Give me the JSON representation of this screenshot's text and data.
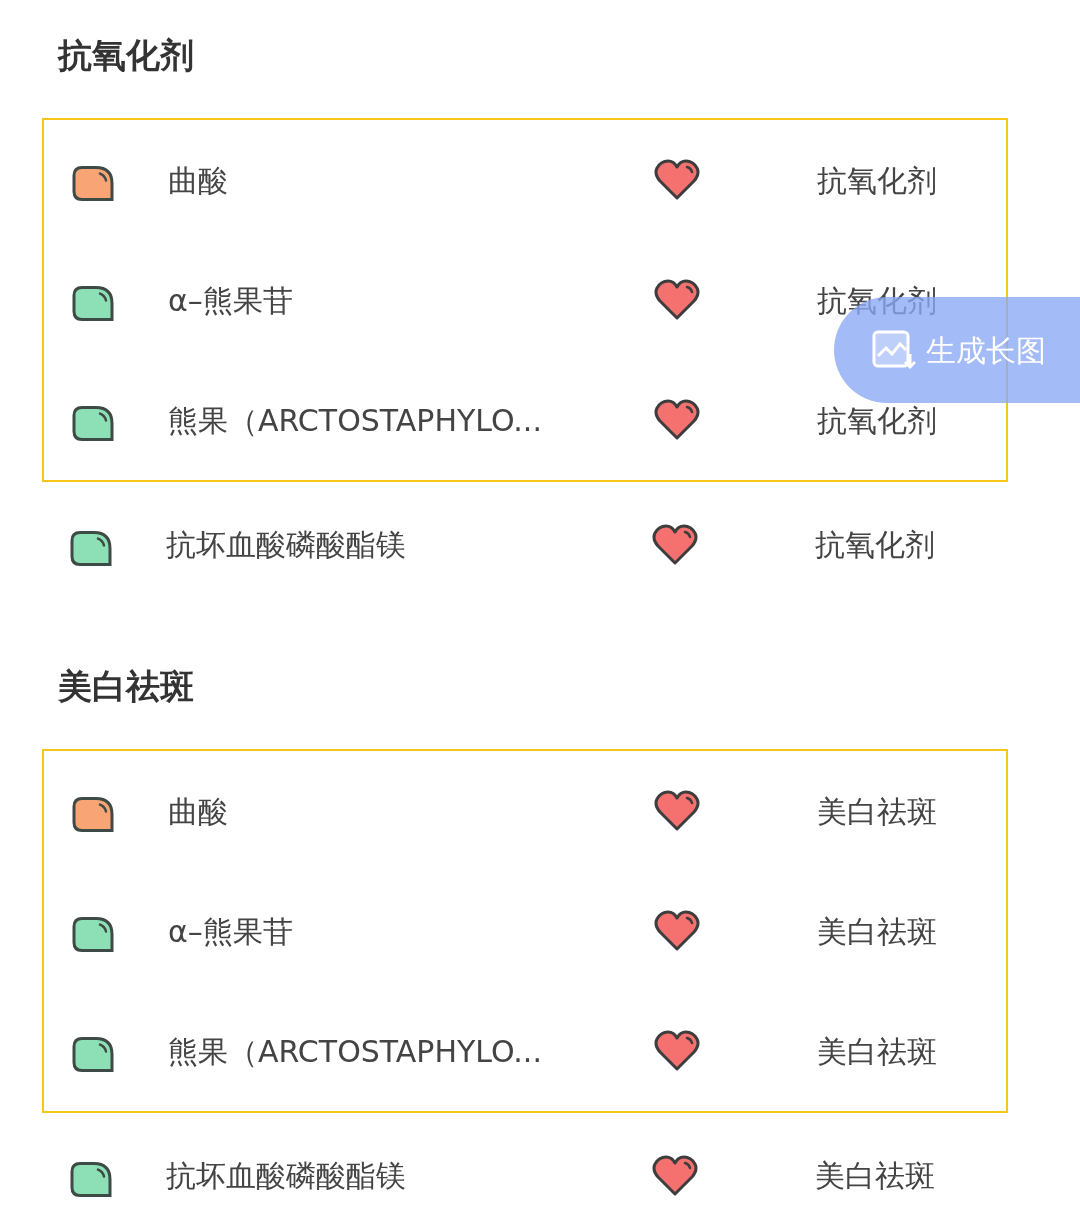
{
  "sections": [
    {
      "title": "抗氧化剂",
      "rows": [
        {
          "name": "曲酸",
          "color": "#f9a474",
          "category": "抗氧化剂",
          "highlighted": true
        },
        {
          "name": "α–熊果苷",
          "color": "#8de0b5",
          "category": "抗氧化剂",
          "highlighted": true
        },
        {
          "name": "熊果（ARCTOSTAPHYLO...",
          "color": "#8de0b5",
          "category": "抗氧化剂",
          "highlighted": true
        },
        {
          "name": "抗坏血酸磷酸酯镁",
          "color": "#8de0b5",
          "category": "抗氧化剂",
          "highlighted": false
        }
      ]
    },
    {
      "title": "美白祛斑",
      "rows": [
        {
          "name": "曲酸",
          "color": "#f9a474",
          "category": "美白祛斑",
          "highlighted": true
        },
        {
          "name": "α–熊果苷",
          "color": "#8de0b5",
          "category": "美白祛斑",
          "highlighted": true
        },
        {
          "name": "熊果（ARCTOSTAPHYLO...",
          "color": "#8de0b5",
          "category": "美白祛斑",
          "highlighted": true
        },
        {
          "name": "抗坏血酸磷酸酯镁",
          "color": "#8de0b5",
          "category": "美白祛斑",
          "highlighted": false
        }
      ]
    }
  ],
  "floating_button": {
    "label": "生成长图"
  }
}
